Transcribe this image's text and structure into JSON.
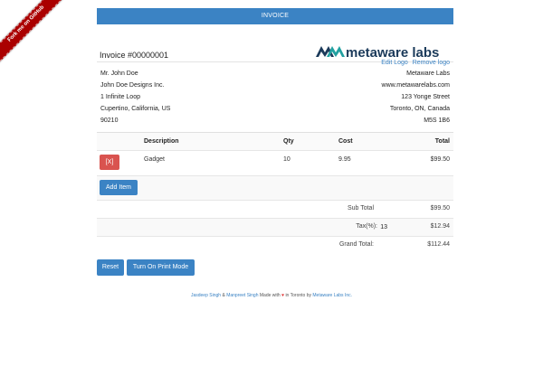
{
  "ribbon": {
    "label": "Fork me on GitHub"
  },
  "header": {
    "title": "INVOICE",
    "invoice_number": "Invoice #00000001"
  },
  "logo": {
    "brand_text": "metaware labs",
    "edit_label": "Edit Logo",
    "remove_label": "Remove logo"
  },
  "billing_to": [
    "Mr. John Doe",
    "John Doe Designs Inc.",
    "1 Infinite Loop",
    "Cupertino, California, US",
    "90210"
  ],
  "billing_from": [
    "Metaware Labs",
    "www.metawarelabs.com",
    "123 Yonge Street",
    "Toronto, ON, Canada",
    "M5S 1B6"
  ],
  "table": {
    "headers": {
      "description": "Description",
      "qty": "Qty",
      "cost": "Cost",
      "total": "Total"
    },
    "items": [
      {
        "delete_label": "[X]",
        "description": "Gadget",
        "qty": "10",
        "cost": "9.95",
        "total": "$99.50"
      }
    ],
    "add_item_label": "Add Item"
  },
  "summary": {
    "subtotal_label": "Sub Total",
    "subtotal_value": "$99.50",
    "tax_label": "Tax(%):",
    "tax_rate": "13",
    "tax_value": "$12.94",
    "grand_total_label": "Grand Total:",
    "grand_total_value": "$112.44"
  },
  "actions": {
    "reset_label": "Reset",
    "print_mode_label": "Turn On Print Mode"
  },
  "footer": {
    "author1": "Jasdeep Singh",
    "amp": "&",
    "author2": "Manpreet Singh",
    "made_with": "Made with",
    "heart": "♥",
    "in_toronto_by": "in Toronto by",
    "company": "Metaware Labs Inc."
  },
  "colors": {
    "accent": "#3b83c4",
    "danger": "#d9534f",
    "ribbon": "#aa0000"
  }
}
